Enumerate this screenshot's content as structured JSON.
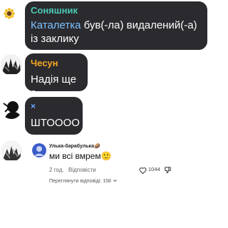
{
  "messages": [
    {
      "sender": "Соняшник",
      "sender_color": "#4cc9b0",
      "mention": "Каталетка",
      "text": " був(-ла) видалений(-а) із заклику"
    },
    {
      "sender": "Чесун",
      "sender_color": "#f5a623",
      "text": "Надія ще є"
    },
    {
      "sender": "×",
      "sender_color": "#6aa8ff",
      "text": "ШТОООО"
    }
  ],
  "comment": {
    "author": "Улька-барабулька",
    "author_emoji": "🥔",
    "text": "ми всі вмрем",
    "text_emoji": "🙂",
    "time": "2 год.",
    "reply_label": "Відповісти",
    "likes": "1044",
    "view_replies": "Переглянути відповіді: 158"
  },
  "icons": [
    "sunflower-avatar-icon",
    "heart-icon",
    "dislike-icon",
    "chevron-down-icon"
  ]
}
